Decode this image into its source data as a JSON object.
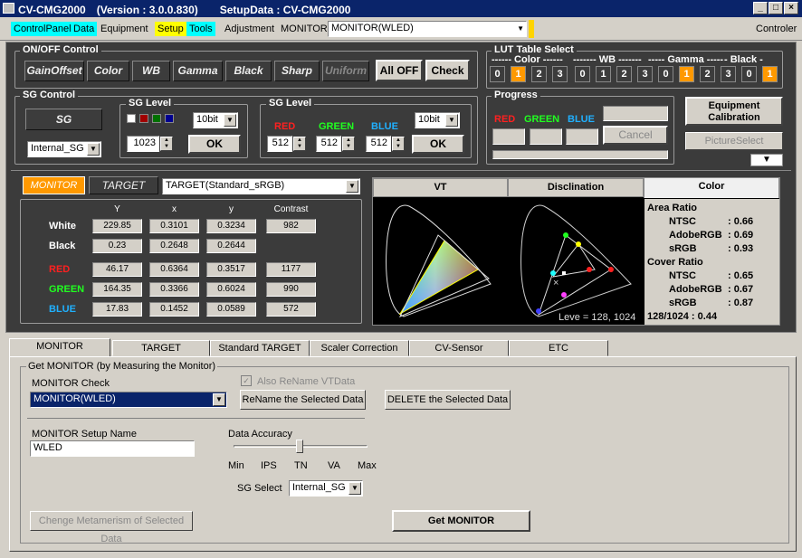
{
  "window": {
    "title": "CV-CMG2000　(Version : 3.0.0.830)　　SetupData : CV-CMG2000",
    "min": "_",
    "max": "□",
    "close": "×"
  },
  "menu": {
    "items": [
      "ControlPanel",
      "Data",
      "Equipment",
      "Setup",
      "Tools",
      "Adjustment",
      "MONITOR"
    ],
    "monitor_select": "MONITOR(WLED)",
    "right_label": "Controler"
  },
  "onoff": {
    "title": "ON/OFF Control",
    "buttons": [
      "GainOffset",
      "Color",
      "WB",
      "Gamma",
      "Black",
      "Sharp",
      "Uniform"
    ],
    "all_off": "All OFF",
    "check": "Check"
  },
  "lut": {
    "title": "LUT Table Select",
    "groups": [
      {
        "label": "------ Color ------",
        "values": [
          "0",
          "1",
          "2",
          "3"
        ],
        "active": 1
      },
      {
        "label": "------- WB -------",
        "values": [
          "0",
          "1",
          "2",
          "3"
        ],
        "active": -1
      },
      {
        "label": "----- Gamma -----",
        "values": [
          "0",
          "1",
          "2",
          "3"
        ],
        "active": 1
      },
      {
        "label": "- Black -",
        "values": [
          "0",
          "1"
        ],
        "active": 1
      }
    ]
  },
  "sg_control": {
    "title": "SG Control",
    "sg_button": "SG",
    "source": "Internal_SG"
  },
  "sg_level1": {
    "title": "SG Level",
    "bits": "10bit",
    "value": "1023",
    "ok": "OK"
  },
  "sg_level2": {
    "title": "SG Level",
    "red": "RED",
    "green": "GREEN",
    "blue": "BLUE",
    "bits": "10bit",
    "r": "512",
    "g": "512",
    "b": "512",
    "ok": "OK"
  },
  "progress": {
    "title": "Progress",
    "red": "RED",
    "green": "GREEN",
    "blue": "BLUE",
    "cancel": "Cancel"
  },
  "right_buttons": {
    "equipment": "Equipment Calibration",
    "picture": "PictureSelect"
  },
  "measure": {
    "monitor_tab": "MONITOR",
    "target_tab": "TARGET",
    "target_select": "TARGET(Standard_sRGB)",
    "headers": [
      "Y",
      "x",
      "y",
      "Contrast"
    ],
    "rows": [
      {
        "name": "White",
        "color": "#ffffff",
        "Y": "229.85",
        "x": "0.3101",
        "y": "0.3234",
        "c": "982"
      },
      {
        "name": "Black",
        "color": "#ffffff",
        "Y": "0.23",
        "x": "0.2648",
        "y": "0.2644",
        "c": ""
      },
      {
        "name": "RED",
        "color": "#ff2020",
        "Y": "46.17",
        "x": "0.6364",
        "y": "0.3517",
        "c": "1177"
      },
      {
        "name": "GREEN",
        "color": "#20ff20",
        "Y": "164.35",
        "x": "0.3366",
        "y": "0.6024",
        "c": "990"
      },
      {
        "name": "BLUE",
        "color": "#20b0ff",
        "Y": "17.83",
        "x": "0.1452",
        "y": "0.0589",
        "c": "572"
      }
    ]
  },
  "chart_tabs": [
    "VT",
    "Disclination",
    "Color"
  ],
  "level_text": "Leve = 128, 1024",
  "ratios": {
    "area_title": "Area Ratio",
    "area": [
      {
        "k": "NTSC",
        "v": ": 0.66"
      },
      {
        "k": "AdobeRGB",
        "v": ": 0.69"
      },
      {
        "k": "sRGB",
        "v": ": 0.93"
      }
    ],
    "cover_title": "Cover Ratio",
    "cover": [
      {
        "k": "NTSC",
        "v": ": 0.65"
      },
      {
        "k": "AdobeRGB",
        "v": ": 0.67"
      },
      {
        "k": "sRGB",
        "v": ": 0.87"
      }
    ],
    "footer": "128/1024 : 0.44"
  },
  "bottom_tabs": [
    "MONITOR",
    "TARGET",
    "Standard TARGET",
    "Scaler Correction",
    "CV-Sensor",
    "ETC"
  ],
  "get_monitor": {
    "group_title": "Get MONITOR (by Measuring the Monitor)",
    "check_label": "MONITOR Check",
    "also_rename": "Also ReName VTData",
    "monitor_value": "MONITOR(WLED)",
    "rename_btn": "ReName the Selected Data",
    "delete_btn": "DELETE the Selected Data",
    "setup_name_label": "MONITOR Setup Name",
    "setup_name": "WLED",
    "accuracy_label": "Data Accuracy",
    "accuracy_ticks": [
      "Min",
      "IPS",
      "TN",
      "VA",
      "Max"
    ],
    "sg_select_label": "SG Select",
    "sg_select": "Internal_SG",
    "metamerism_btn": "Chenge Metamerism of Selected Data",
    "get_btn": "Get MONITOR"
  }
}
